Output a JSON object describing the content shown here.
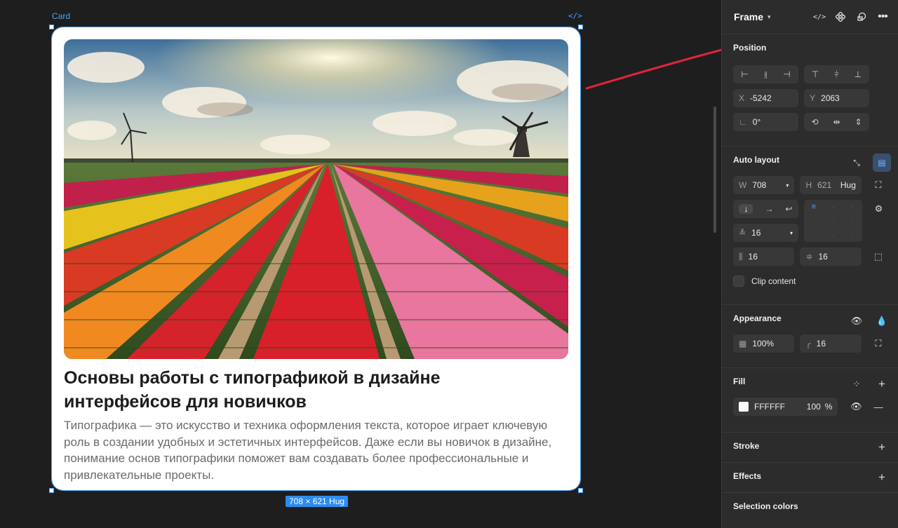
{
  "canvas": {
    "frame_label": "Card",
    "code_icon": "</>",
    "size_badge": "708 × 621 Hug"
  },
  "card": {
    "title": "Основы работы с типографикой в дизайне интерфейсов для новичков",
    "text": "Типографика — это искусство и техника оформления текста, которое играет ключевую роль в создании удобных и эстетичных интерфейсов. Даже если вы новичок в дизайне, понимание основ типографики поможет вам создавать более профессиональные и привлекательные проекты."
  },
  "panel": {
    "title": "Frame",
    "position": {
      "title": "Position",
      "x_label": "X",
      "x": "-5242",
      "y_label": "Y",
      "y": "2063",
      "rotation": "0°"
    },
    "auto_layout": {
      "title": "Auto layout",
      "w_label": "W",
      "w": "708",
      "h_label": "H",
      "h": "621",
      "h_mode": "Hug",
      "gap": "16",
      "padding_h": "16",
      "padding_v": "16",
      "clip_label": "Clip content"
    },
    "appearance": {
      "title": "Appearance",
      "opacity": "100%",
      "radius": "16"
    },
    "fill": {
      "title": "Fill",
      "color": "FFFFFF",
      "opacity": "100",
      "percent": "%"
    },
    "stroke": {
      "title": "Stroke"
    },
    "effects": {
      "title": "Effects"
    },
    "selection_colors": {
      "title": "Selection colors"
    }
  },
  "colors": {
    "accent": "#4aa3ff",
    "annotation": "#e0243a",
    "panel_bg": "#2c2c2c",
    "canvas_bg": "#1e1e1e"
  }
}
